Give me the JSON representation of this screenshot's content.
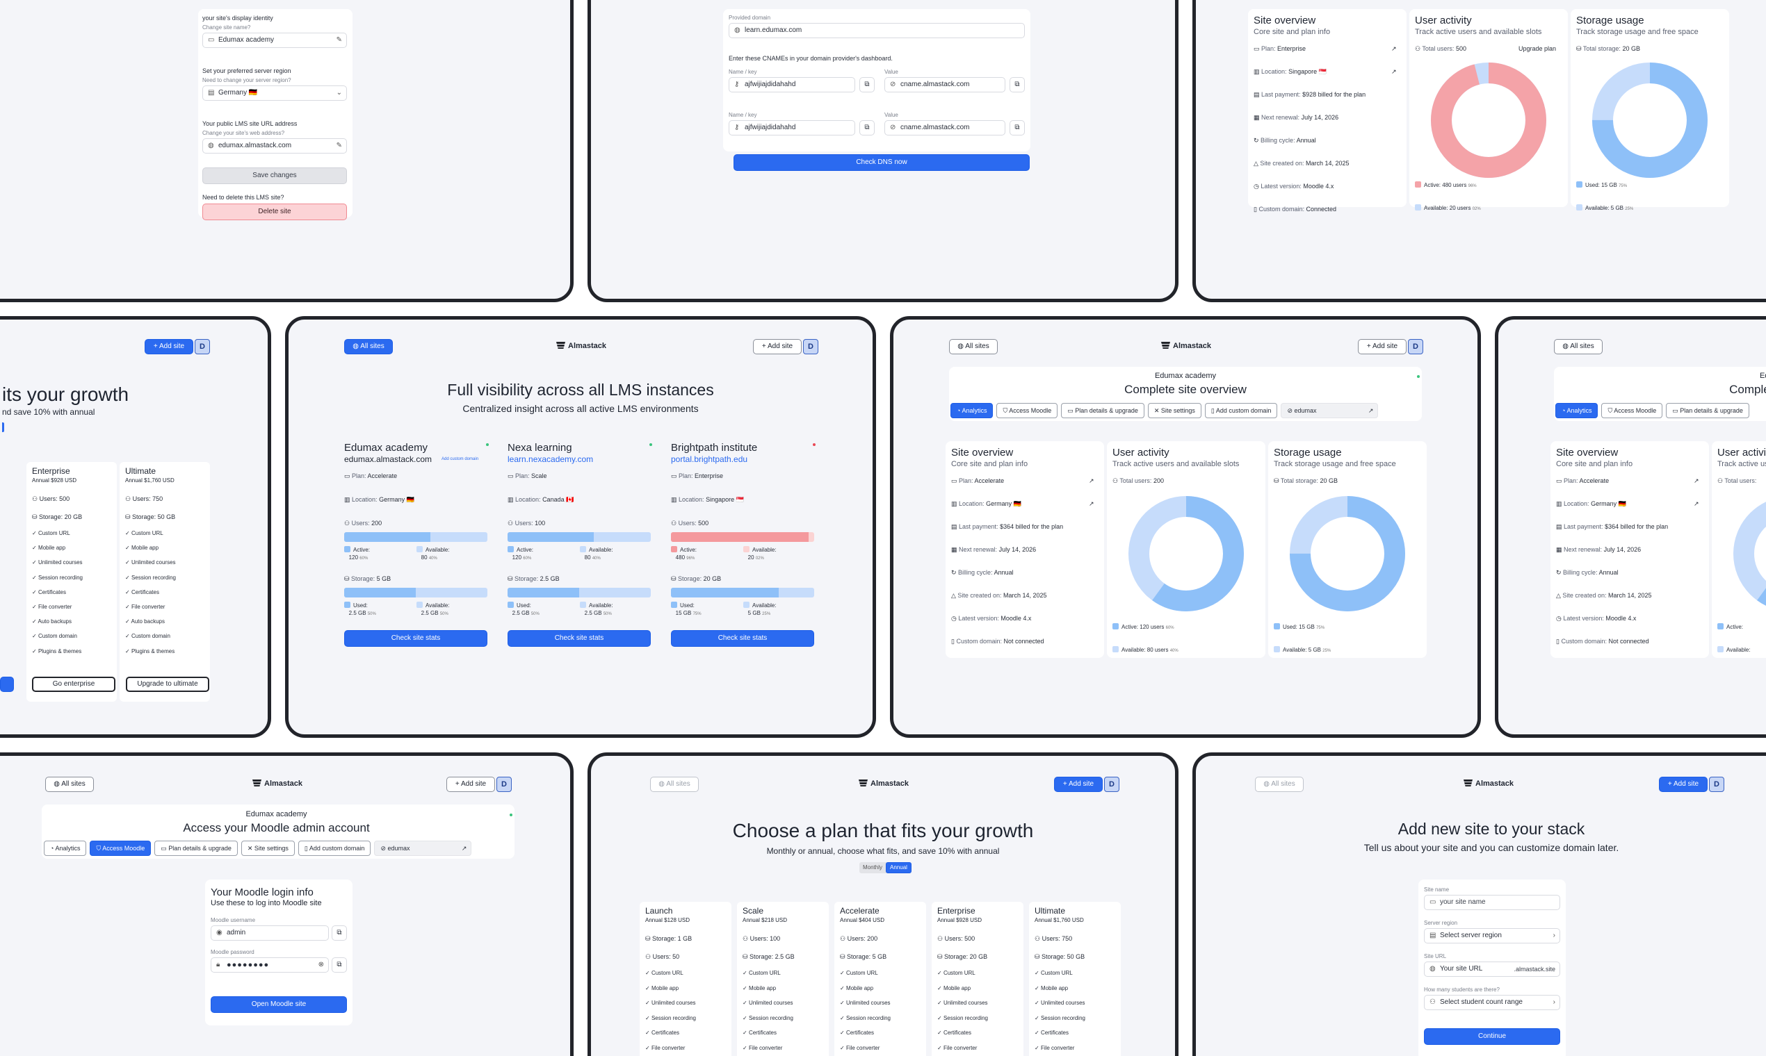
{
  "brand": "Almastack",
  "nav": {
    "all_sites": "All sites",
    "add_site": "+ Add site",
    "avatar": "D"
  },
  "colors": {
    "accent": "#2b6af0",
    "used": "#8ec0f8",
    "free": "#c6dcfb",
    "danger": "#f4999d"
  },
  "settings": {
    "identity_title": "your site's display identity",
    "identity_sub": "Change site name?",
    "site_name": "Edumax academy",
    "region_title": "Set your preferred server region",
    "region_sub": "Need to change your server region?",
    "region_value": "Germany 🇩🇪",
    "url_title": "Your public LMS site URL address",
    "url_sub": "Change your site's web address?",
    "url_value": "edumax.almastack.com",
    "save": "Save changes",
    "delete_q": "Need to delete this LMS site?",
    "delete": "Delete site"
  },
  "dns": {
    "provided_label": "Provided domain",
    "provided_value": "learn.edumax.com",
    "instruction": "Enter these CNAMEs in your domain provider's dashboard.",
    "name_label": "Name / key",
    "value_label": "Value",
    "records": [
      {
        "name": "ajfwijiajdidahahd",
        "value": "cname.almastack.com"
      },
      {
        "name": "ajfwijiajdidahahd",
        "value": "cname.almastack.com"
      }
    ],
    "check": "Check DNS now"
  },
  "overview_top": {
    "title": "Site overview",
    "sub": "Core site and plan info",
    "rows": [
      {
        "k": "Plan:",
        "v": "Enterprise"
      },
      {
        "k": "Location:",
        "v": "Singapore 🇸🇬"
      },
      {
        "k": "Last payment:",
        "v": "$928 billed for the plan"
      },
      {
        "k": "Next renewal:",
        "v": "July 14, 2026"
      },
      {
        "k": "Billing cycle:",
        "v": "Annual"
      },
      {
        "k": "Site created on:",
        "v": "March 14, 2025"
      },
      {
        "k": "Latest version:",
        "v": "Moodle 4.x"
      },
      {
        "k": "Custom domain:",
        "v": "Connected"
      }
    ],
    "users_title": "User activity",
    "users_sub": "Track active users and available slots",
    "total_users_label": "Total users:",
    "total_users": "500",
    "upgrade": "Upgrade plan",
    "active_label": "Active:",
    "active": "480 users",
    "active_pct": "96%",
    "available_label": "Available:",
    "available": "20 users",
    "available_pct": "02%",
    "active_fraction": 0.96,
    "storage_title": "Storage usage",
    "storage_sub": "Track storage usage and free space",
    "total_storage_label": "Total storage:",
    "total_storage": "20 GB",
    "used_label": "Used:",
    "used": "15 GB",
    "used_pct": "75%",
    "free_label": "Available:",
    "free": "5 GB",
    "free_pct": "25%",
    "used_fraction": 0.75
  },
  "pricing_partial": {
    "title_end": "its your growth",
    "sub_end": "nd save 10% with annual",
    "plans": [
      {
        "name": "Enterprise",
        "price": "Annual $928 USD",
        "users": "Users: 500",
        "storage": "Storage: 20 GB",
        "cta": "Go enterprise"
      },
      {
        "name": "Ultimate",
        "price": "Annual $1,760 USD",
        "users": "Users: 750",
        "storage": "Storage: 50 GB",
        "cta": "Upgrade to ultimate"
      }
    ],
    "features": [
      "Custom URL",
      "Mobile app",
      "Unlimited courses",
      "Session recording",
      "Certificates",
      "File converter",
      "Auto backups",
      "Custom domain",
      "Plugins & themes"
    ]
  },
  "dashboard": {
    "title": "Full visibility across all LMS instances",
    "sub": "Centralized insight across all active LMS environments",
    "add_custom_domain": "Add custom domain",
    "check_stats": "Check site stats",
    "sites": [
      {
        "name": "Edumax academy",
        "url": "edumax.almastack.com",
        "plan": "Accelerate",
        "location": "Germany 🇩🇪",
        "users": "200",
        "active": "120",
        "active_pct": "60%",
        "avail": "80",
        "avail_pct": "40%",
        "active_fraction": 0.6,
        "storage": "5 GB",
        "used": "2.5 GB",
        "used_pct": "50%",
        "free": "2.5 GB",
        "free_pct": "50%",
        "used_fraction": 0.5,
        "status": "#3ac47d"
      },
      {
        "name": "Nexa learning",
        "url": "learn.nexacademy.com",
        "plan": "Scale",
        "location": "Canada 🇨🇦",
        "users": "100",
        "active": "120",
        "active_pct": "60%",
        "avail": "80",
        "avail_pct": "40%",
        "active_fraction": 0.6,
        "storage": "2.5 GB",
        "used": "2.5 GB",
        "used_pct": "50%",
        "free": "2.5 GB",
        "free_pct": "50%",
        "used_fraction": 0.5,
        "status": "#3ac47d"
      },
      {
        "name": "Brightpath institute",
        "url": "portal.brightpath.edu",
        "plan": "Enterprise",
        "location": "Singapore 🇸🇬",
        "users": "500",
        "active": "480",
        "active_pct": "96%",
        "avail": "20",
        "avail_pct": "02%",
        "active_fraction": 0.96,
        "storage": "20 GB",
        "used": "15 GB",
        "used_pct": "75%",
        "free": "5 GB",
        "free_pct": "25%",
        "used_fraction": 0.75,
        "status": "#e84855"
      }
    ],
    "labels": {
      "plan": "Plan:",
      "location": "Location:",
      "users": "Users:",
      "active": "Active:",
      "available": "Available:",
      "storage": "Storage:",
      "used": "Used:"
    }
  },
  "site_detail": {
    "site": "Edumax academy",
    "title": "Complete site overview",
    "tabs": [
      "Analytics",
      "Access Moodle",
      "Plan details & upgrade",
      "Site settings",
      "Add custom domain"
    ],
    "link": "edumax",
    "rows": [
      {
        "k": "Plan:",
        "v": "Accelerate"
      },
      {
        "k": "Location:",
        "v": "Germany 🇩🇪"
      },
      {
        "k": "Last payment:",
        "v": "$364 billed for the plan"
      },
      {
        "k": "Next renewal:",
        "v": "July 14, 2026"
      },
      {
        "k": "Billing cycle:",
        "v": "Annual"
      },
      {
        "k": "Site created on:",
        "v": "March 14, 2025"
      },
      {
        "k": "Latest version:",
        "v": "Moodle 4.x"
      },
      {
        "k": "Custom domain:",
        "v": "Not connected"
      }
    ],
    "total_users": "200",
    "active": "120 users",
    "active_pct": "60%",
    "available": "80 users",
    "available_pct": "40%",
    "active_fraction": 0.6,
    "total_storage": "20 GB",
    "used": "15 GB",
    "used_pct": "75%",
    "free": "5 GB",
    "free_pct": "25%",
    "used_fraction": 0.75
  },
  "moodle": {
    "site": "Edumax academy",
    "title": "Access your Moodle admin account",
    "card_title": "Your Moodle login info",
    "card_sub": "Use these to log into Moodle site",
    "user_label": "Moodle username",
    "user": "admin",
    "pass_label": "Moodle password",
    "pass": "●●●●●●●●",
    "open": "Open Moodle site"
  },
  "pricing": {
    "title": "Choose a plan that fits your growth",
    "sub": "Monthly or annual, choose what fits, and save 10% with annual",
    "toggle": [
      "Monthly",
      "Annual"
    ],
    "plans": [
      {
        "name": "Launch",
        "price": "Annual $128 USD",
        "a": "Storage: 1 GB",
        "b": "Users: 50"
      },
      {
        "name": "Scale",
        "price": "Annual $218 USD",
        "a": "Users: 100",
        "b": "Storage: 2.5 GB"
      },
      {
        "name": "Accelerate",
        "price": "Annual $404 USD",
        "a": "Users: 200",
        "b": "Storage: 5 GB"
      },
      {
        "name": "Enterprise",
        "price": "Annual $928 USD",
        "a": "Users: 500",
        "b": "Storage: 20 GB"
      },
      {
        "name": "Ultimate",
        "price": "Annual $1,760 USD",
        "a": "Users: 750",
        "b": "Storage: 50 GB"
      }
    ],
    "features": [
      "Custom URL",
      "Mobile app",
      "Unlimited courses",
      "Session recording",
      "Certificates",
      "File converter"
    ]
  },
  "add_site": {
    "title": "Add new site to your stack",
    "sub": "Tell us about your site and you can customize domain later.",
    "name_label": "Site name",
    "name_ph": "your site name",
    "region_label": "Server region",
    "region_ph": "Select server region",
    "url_label": "Site URL",
    "url_ph": "Your site URL",
    "url_suffix": ".almastack.site",
    "students_label": "How many students are there?",
    "students_ph": "Select student count range",
    "continue": "Continue"
  }
}
